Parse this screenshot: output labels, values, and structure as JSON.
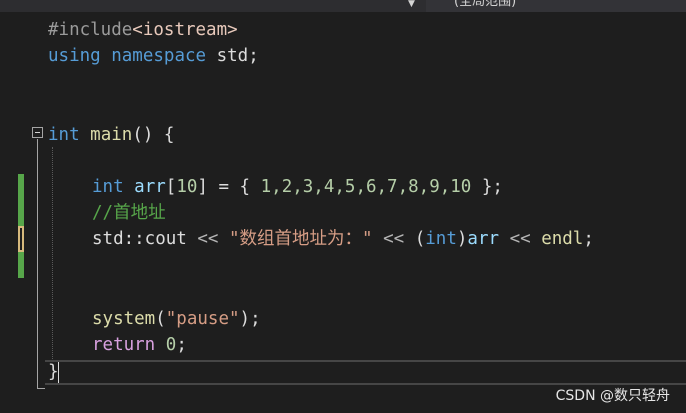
{
  "scope_bar": {
    "scope_label": "(全局范围)",
    "dropdown_icon": "chevron-down-icon"
  },
  "code": {
    "line1": {
      "directive": "#include",
      "header": "<iostream>"
    },
    "line2": {
      "kw1": "using",
      "kw2": "namespace",
      "name": "std",
      "semi": ";"
    },
    "line5": {
      "type": "int",
      "name": "main",
      "rest": "() {"
    },
    "line7": {
      "type": "int",
      "var": "arr",
      "dim": "10",
      "eq": " = { ",
      "values": "1,2,3,4,5,6,7,8,9,10",
      "end": " };"
    },
    "line8": {
      "comment": "//首地址"
    },
    "line9": {
      "stream": "std::cout",
      "op1": " << ",
      "str": "\"数组首地址为：\"",
      "op2": " << ",
      "cast_open": "(",
      "cast_type": "int",
      "cast_close": ")",
      "var": "arr",
      "op3": " << ",
      "endl": "endl",
      "semi": ";"
    },
    "line12": {
      "fn": "system",
      "open": "(",
      "str": "\"pause\"",
      "close": ");"
    },
    "line13": {
      "kw": "return",
      "num": "0",
      "semi": ";"
    },
    "line14": {
      "brace": "}"
    }
  },
  "watermark": "CSDN @数只轻舟",
  "colors": {
    "background": "#1e1e1e",
    "keyword": "#569cd6",
    "control_keyword": "#d8a0df",
    "function": "#dcdcaa",
    "string": "#d69d85",
    "comment": "#57a64a",
    "number": "#b5cea8",
    "change_saved": "#57a64a",
    "change_unsaved": "#d7ba7d"
  }
}
